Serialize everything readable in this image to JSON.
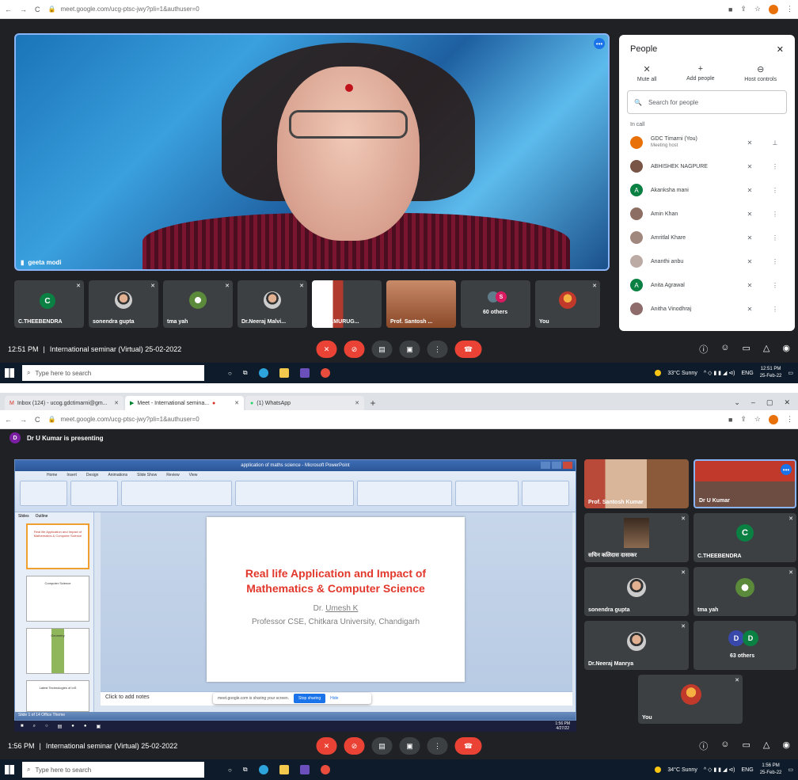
{
  "top": {
    "address": {
      "url": "meet.google.com/ucg-ptsc-jwy?pli=1&authuser=0"
    },
    "main_speaker": {
      "name": "geeta modi"
    },
    "thumbnails": [
      {
        "name": "C.THEEBENDRA",
        "letter": "C",
        "color": "#0b8043"
      },
      {
        "name": "sonendra gupta"
      },
      {
        "name": "tma yah"
      },
      {
        "name": "Dr.Neeraj Malvi..."
      },
      {
        "name": "Dr S.V.MURUG..."
      },
      {
        "name": "Prof. Santosh ..."
      },
      {
        "name": "60 others",
        "letter": "S",
        "color": "#d81b60"
      },
      {
        "name": "You"
      }
    ],
    "bar": {
      "time": "12:51 PM",
      "sep": "|",
      "meeting": "International seminar (Virtual) 25-02-2022"
    },
    "people": {
      "title": "People",
      "mute_all": "Mute all",
      "add_people": "Add people",
      "host_controls": "Host controls",
      "search_placeholder": "Search for people",
      "section": "In call",
      "rows": [
        {
          "name": "GDC Timarni (You)",
          "sub": "Meeting host",
          "color": "#e8710a"
        },
        {
          "name": "ABHISHEK NAGPURE",
          "color": "#795548"
        },
        {
          "name": "Akanksha mani",
          "letter": "A",
          "color": "#0b8043"
        },
        {
          "name": "Amin Khan",
          "color": "#8d6e63"
        },
        {
          "name": "Amritlal Khare",
          "color": "#a1887f"
        },
        {
          "name": "Ananthi anbu",
          "color": "#bcaaa4"
        },
        {
          "name": "Anita Agrawal",
          "letter": "A",
          "color": "#0b8043"
        },
        {
          "name": "Anitha Vinodhraj",
          "color": "#8e6c6c"
        }
      ]
    },
    "taskbar": {
      "search": "Type here to search",
      "weather": "33°C Sunny",
      "lang": "ENG",
      "time": "12:51 PM",
      "date": "25-Feb-22"
    }
  },
  "bottom": {
    "tabs": [
      {
        "label": "Inbox (124) - ucog.gdctimarni@gm..."
      },
      {
        "label": "Meet - International semina..."
      },
      {
        "label": "(1) WhatsApp"
      }
    ],
    "address": {
      "url": "meet.google.com/ucg-ptsc-jwy?pli=1&authuser=0"
    },
    "presenting": {
      "letter": "D",
      "text": "Dr U Kumar is presenting"
    },
    "ppt": {
      "window_title": "application of maths science - Microsoft PowerPoint",
      "ribbon_tabs": [
        "Home",
        "Insert",
        "Design",
        "Animations",
        "Slide Show",
        "Review",
        "View"
      ],
      "pane_tabs": [
        "Slides",
        "Outline"
      ],
      "slide": {
        "title_line1": "Real life Application and Impact of",
        "title_line2": "Mathematics & Computer Science",
        "author_prefix": "Dr. ",
        "author_name": "Umesh K",
        "affiliation": "Professor CSE,  Chitkara University, Chandigarh"
      },
      "thumb_titles": [
        "Real life Application and Impact of Mathematics & Computer Science",
        "Computer Science",
        "Geometry",
        "Latest Technologies of IoS"
      ],
      "notes": "Click to add notes",
      "status": "Slide 1 of 14    Office Theme",
      "inner_clock": {
        "time": "1:56 PM",
        "date": "4/27/22"
      }
    },
    "sharing": {
      "text": "meet.google.com is sharing your screen.",
      "stop": "Stop sharing",
      "hide": "Hide"
    },
    "tiles": [
      {
        "name": "Prof. Santosh Kumar"
      },
      {
        "name": "Dr U Kumar"
      },
      {
        "name": "सचिन कलिदास दासाकर"
      },
      {
        "name": "C.THEEBENDRA",
        "letter": "C",
        "color": "#0b8043"
      },
      {
        "name": "sonendra gupta"
      },
      {
        "name": "tma yah"
      },
      {
        "name": "Dr.Neeraj Manrya"
      },
      {
        "name": "63 others",
        "letters": [
          "D",
          "D"
        ],
        "colors": [
          "#3949ab",
          "#0b8043"
        ]
      },
      {
        "name": "You"
      }
    ],
    "bar": {
      "time": "1:56 PM",
      "sep": "|",
      "meeting": "International seminar (Virtual) 25-02-2022"
    },
    "taskbar": {
      "search": "Type here to search",
      "weather": "34°C Sunny",
      "lang": "ENG",
      "time": "1:56 PM",
      "date": "25-Feb-22"
    }
  },
  "icons": {
    "mic_off": "mic-off-icon",
    "cam_off": "camera-off-icon",
    "cc": "captions-icon",
    "present": "present-icon",
    "more": "more-vert-icon",
    "hangup": "call-end-icon"
  },
  "colors": {
    "meet_bg": "#202124",
    "accent": "#1a73e8",
    "danger": "#ea4335",
    "tile": "#3c4043"
  }
}
